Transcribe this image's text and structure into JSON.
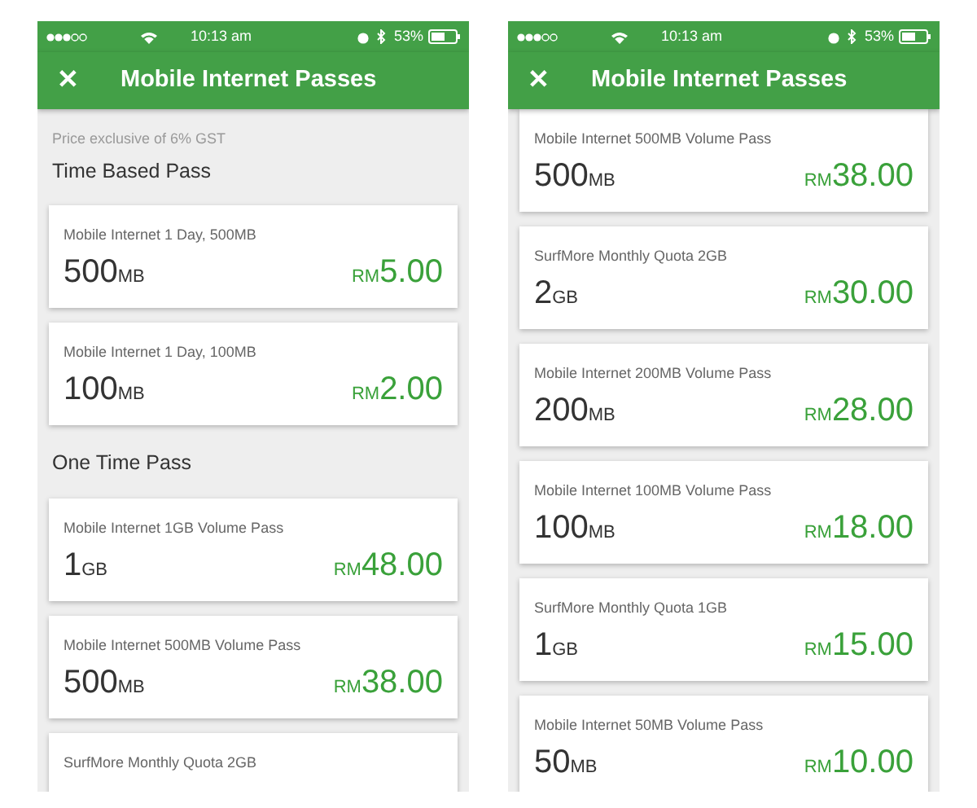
{
  "phones": [
    {
      "status_bar": {
        "time": "10:13 am",
        "battery": "53%"
      },
      "header": {
        "close": "✕",
        "title": "Mobile Internet Passes"
      },
      "items": [
        {
          "kind": "note",
          "text": "Price exclusive of 6% GST"
        },
        {
          "kind": "section",
          "text": "Time Based Pass"
        },
        {
          "kind": "pass",
          "name": "Mobile Internet 1 Day, 500MB",
          "amount": "500",
          "unit": "MB",
          "currency": "RM",
          "price": "5.00"
        },
        {
          "kind": "pass",
          "name": "Mobile Internet 1 Day, 100MB",
          "amount": "100",
          "unit": "MB",
          "currency": "RM",
          "price": "2.00"
        },
        {
          "kind": "section",
          "text": "One Time Pass"
        },
        {
          "kind": "pass",
          "name": "Mobile Internet 1GB Volume Pass",
          "amount": "1",
          "unit": "GB",
          "currency": "RM",
          "price": "48.00"
        },
        {
          "kind": "pass",
          "name": "Mobile Internet 500MB Volume Pass",
          "amount": "500",
          "unit": "MB",
          "currency": "RM",
          "price": "38.00"
        },
        {
          "kind": "pass",
          "name": "SurfMore Monthly Quota 2GB"
        }
      ]
    },
    {
      "status_bar": {
        "time": "10:13 am",
        "battery": "53%"
      },
      "header": {
        "close": "✕",
        "title": "Mobile Internet Passes"
      },
      "items": [
        {
          "kind": "pass",
          "name": "Mobile Internet 500MB Volume Pass",
          "amount": "500",
          "unit": "MB",
          "currency": "RM",
          "price": "38.00"
        },
        {
          "kind": "pass",
          "name": "SurfMore Monthly Quota 2GB",
          "amount": "2",
          "unit": "GB",
          "currency": "RM",
          "price": "30.00"
        },
        {
          "kind": "pass",
          "name": "Mobile Internet 200MB Volume Pass",
          "amount": "200",
          "unit": "MB",
          "currency": "RM",
          "price": "28.00"
        },
        {
          "kind": "pass",
          "name": "Mobile Internet 100MB Volume Pass",
          "amount": "100",
          "unit": "MB",
          "currency": "RM",
          "price": "18.00"
        },
        {
          "kind": "pass",
          "name": "SurfMore Monthly Quota 1GB",
          "amount": "1",
          "unit": "GB",
          "currency": "RM",
          "price": "15.00"
        },
        {
          "kind": "pass",
          "name": "Mobile Internet 50MB Volume Pass",
          "amount": "50",
          "unit": "MB",
          "currency": "RM",
          "price": "10.00"
        }
      ]
    }
  ]
}
